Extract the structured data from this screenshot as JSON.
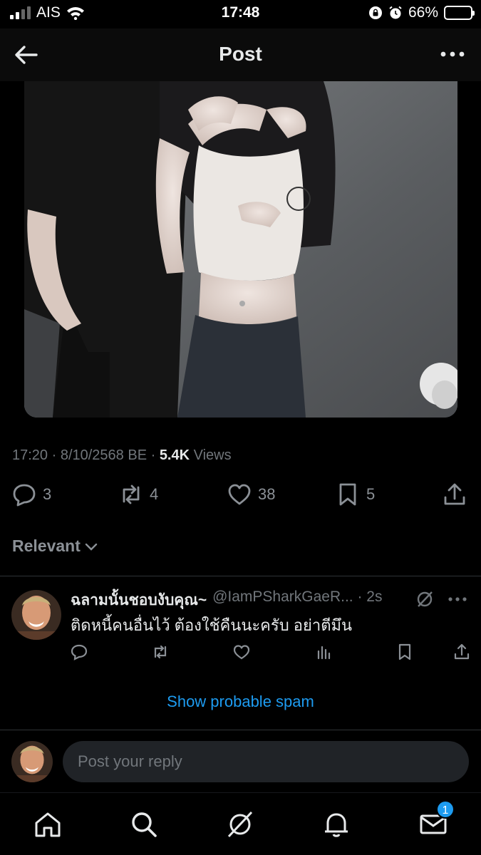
{
  "status_bar": {
    "carrier": "AIS",
    "time": "17:48",
    "battery": "66%",
    "battery_level": 0.66
  },
  "header": {
    "title": "Post"
  },
  "post": {
    "timestamp": "17:20 · 8/10/2568 BE · ",
    "views_count": "5.4K",
    "views_label": " Views",
    "replies": "3",
    "reposts": "4",
    "likes": "38",
    "bookmarks": "5"
  },
  "replies_sort": {
    "label": "Relevant"
  },
  "reply": {
    "display_name": "ฉลามนั้นชอบงับคุณ~",
    "handle": "@IamPSharkGaeR... · 2s",
    "text": "ติดหนี้คนอื่นไว้ ต้องใช้คืนนะครับ อย่าตีมึน"
  },
  "spam_link": {
    "label": "Show probable spam"
  },
  "composer": {
    "placeholder": "Post your reply"
  },
  "tabbar": {
    "messages_badge": "1"
  },
  "colors": {
    "accent": "#1d9bf0",
    "muted": "#71767b",
    "background": "#000000"
  }
}
